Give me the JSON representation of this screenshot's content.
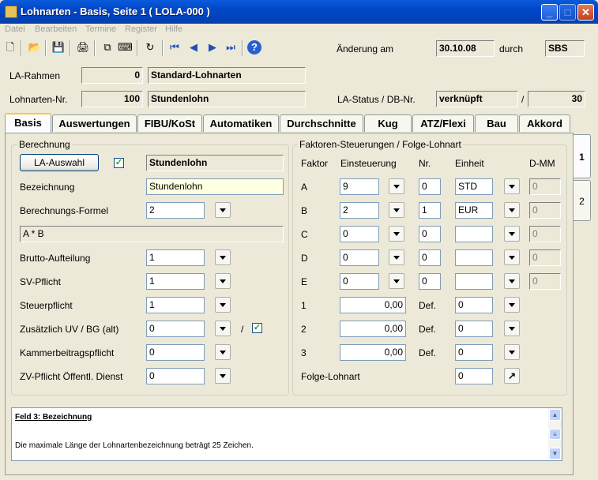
{
  "window": {
    "title": "Lohnarten - Basis, Seite 1  ( LOLA-000 )",
    "minimize": "_",
    "maximize": "□",
    "close": "✕"
  },
  "menu": [
    "Datei",
    "Bearbeiten",
    "Termine",
    "Register",
    "Hilfe"
  ],
  "toolbar": {
    "icons": [
      "new-icon",
      "open-icon",
      "save-icon",
      "print-icon",
      "copy-icon",
      "keyboard-icon",
      "refresh-icon",
      "first-record-icon",
      "prev-record-icon",
      "next-record-icon",
      "last-record-icon",
      "help-icon"
    ],
    "glyphs": [
      "🗋",
      "📂",
      "💾",
      "🖨",
      "⧉",
      "⌨",
      "↻",
      "⏮",
      "◀",
      "▶",
      "⏭",
      "?"
    ],
    "change_label": "Änderung am",
    "change_date": "30.10.08",
    "by_label": "durch",
    "by_value": "SBS"
  },
  "header": {
    "rahmen_label": "LA-Rahmen",
    "rahmen_nr": "0",
    "rahmen_name": "Standard-Lohnarten",
    "nr_label": "Lohnarten-Nr.",
    "nr": "100",
    "nr_name": "Stundenlohn",
    "status_label": "LA-Status / DB-Nr.",
    "status": "verknüpft",
    "status_sep": "/",
    "db_nr": "30"
  },
  "tabs": [
    "Basis",
    "Auswertungen",
    "FIBU/KoSt",
    "Automatiken",
    "Durchschnitte",
    "Kug",
    "ATZ/Flexi",
    "Bau",
    "Akkord"
  ],
  "side_tabs": [
    "1",
    "2"
  ],
  "berechnung": {
    "title": "Berechnung",
    "auswahl_button": "LA-Auswahl",
    "auswahl_checked": "✓",
    "auswahl_value": "Stundenlohn",
    "bezeichnung_label": "Bezeichnung",
    "bezeichnung": "Stundenlohn",
    "formel_label": "Berechnungs-Formel",
    "formel": "2",
    "formel_text": "A * B",
    "rows": [
      {
        "label": "Brutto-Aufteilung",
        "value": "1"
      },
      {
        "label": "SV-Pflicht",
        "value": "1"
      },
      {
        "label": "Steuerpflicht",
        "value": "1"
      },
      {
        "label": "Zusätzlich UV / BG (alt)",
        "value": "0"
      },
      {
        "label": "Kammerbeitragspflicht",
        "value": "0"
      },
      {
        "label": "ZV-Pflicht Öffentl. Dienst",
        "value": "0"
      }
    ],
    "uv_sep": "/",
    "uv_checked": "✓"
  },
  "faktoren": {
    "title": "Faktoren-Steuerungen / Folge-Lohnart",
    "headers": [
      "Faktor",
      "Einsteuerung",
      "Nr.",
      "Einheit",
      "D-MM"
    ],
    "rows": [
      {
        "f": "A",
        "e": "9",
        "nr": "0",
        "unit": "STD",
        "dmm": "0"
      },
      {
        "f": "B",
        "e": "2",
        "nr": "1",
        "unit": "EUR",
        "dmm": "0"
      },
      {
        "f": "C",
        "e": "0",
        "nr": "0",
        "unit": "",
        "dmm": "0"
      },
      {
        "f": "D",
        "e": "0",
        "nr": "0",
        "unit": "",
        "dmm": "0"
      },
      {
        "f": "E",
        "e": "0",
        "nr": "0",
        "unit": "",
        "dmm": "0"
      }
    ],
    "num_rows": [
      {
        "f": "1",
        "val": "0,00",
        "def_label": "Def.",
        "def": "0"
      },
      {
        "f": "2",
        "val": "0,00",
        "def_label": "Def.",
        "def": "0"
      },
      {
        "f": "3",
        "val": "0,00",
        "def_label": "Def.",
        "def": "0"
      }
    ],
    "folge_label": "Folge-Lohnart",
    "folge_value": "0",
    "folge_glyph": "↗"
  },
  "help": {
    "title": "Feld 3: Bezeichnung",
    "text": "Die maximale Länge der Lohnartenbezeichnung beträgt 25 Zeichen."
  }
}
